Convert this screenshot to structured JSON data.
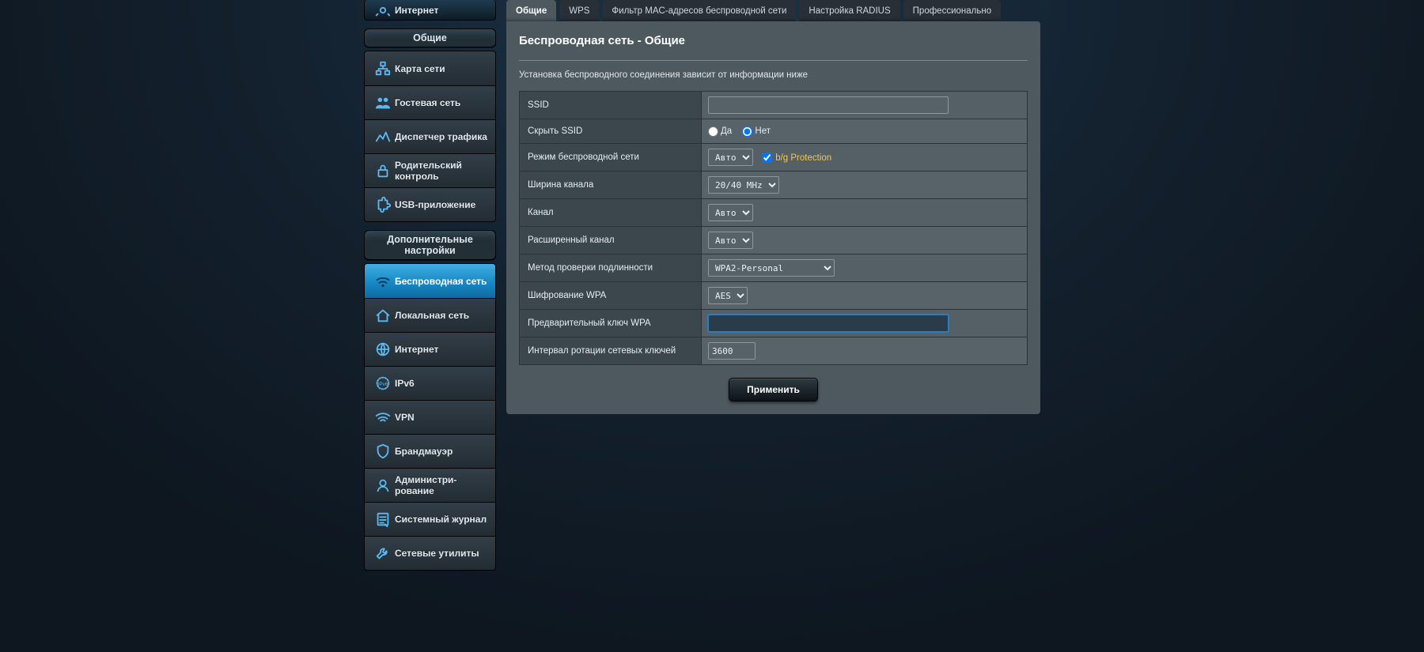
{
  "sidebar": {
    "top_item": "Интернет",
    "groups": [
      {
        "title": "Общие",
        "items": [
          {
            "label": "Карта сети",
            "icon": "network-map"
          },
          {
            "label": "Гостевая сеть",
            "icon": "guest-network"
          },
          {
            "label": "Диспетчер трафика",
            "icon": "traffic"
          },
          {
            "label": "Родительский контроль",
            "icon": "lock"
          },
          {
            "label": "USB-приложение",
            "icon": "puzzle"
          }
        ]
      },
      {
        "title": "Дополнительные настройки",
        "items": [
          {
            "label": "Беспроводная сеть",
            "icon": "wifi",
            "active": true
          },
          {
            "label": "Локальная сеть",
            "icon": "home"
          },
          {
            "label": "Интернет",
            "icon": "globe"
          },
          {
            "label": "IPv6",
            "icon": "ipv6"
          },
          {
            "label": "VPN",
            "icon": "vpn"
          },
          {
            "label": "Брандмауэр",
            "icon": "shield"
          },
          {
            "label": "Администри-рование",
            "icon": "admin"
          },
          {
            "label": "Системный журнал",
            "icon": "log"
          },
          {
            "label": "Сетевые утилиты",
            "icon": "tools"
          }
        ]
      }
    ]
  },
  "tabs": [
    {
      "label": "Общие",
      "active": true
    },
    {
      "label": "WPS"
    },
    {
      "label": "Фильтр MAC-адресов беспроводной сети"
    },
    {
      "label": "Настройка RADIUS"
    },
    {
      "label": "Профессионально"
    }
  ],
  "panel": {
    "title": "Беспроводная сеть - Общие",
    "desc": "Установка беспроводного соединения зависит от информации ниже",
    "apply": "Применить",
    "rows": {
      "ssid": {
        "label": "SSID",
        "value": ""
      },
      "hide": {
        "label": "Скрыть SSID",
        "yes": "Да",
        "no": "Нет",
        "value": "no"
      },
      "mode": {
        "label": "Режим беспроводной сети",
        "value": "Авто",
        "bg_label": "b/g Protection",
        "bg_checked": true
      },
      "bw": {
        "label": "Ширина канала",
        "value": "20/40 MHz"
      },
      "ch": {
        "label": "Канал",
        "value": "Авто"
      },
      "ext": {
        "label": "Расширенный канал",
        "value": "Авто"
      },
      "auth": {
        "label": "Метод проверки подлинности",
        "value": "WPA2-Personal"
      },
      "enc": {
        "label": "Шифрование WPA",
        "value": "AES"
      },
      "psk": {
        "label": "Предварительный ключ WPA",
        "value": ""
      },
      "rekey": {
        "label": "Интервал ротации сетевых ключей",
        "value": "3600"
      }
    }
  }
}
